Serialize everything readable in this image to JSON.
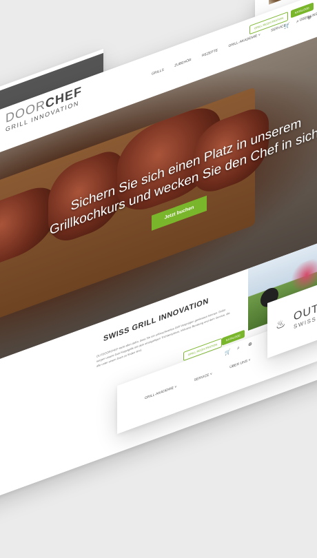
{
  "main": {
    "logo_line1_a": "DOOR",
    "logo_line1_b": "CHEF",
    "logo_line2": "GRILL INNOVATION",
    "menu": [
      "GRILLS",
      "ZUBEHÖR",
      "REZEPTE",
      "GRILL-AKADEMIE ˅",
      "SERVICE ˅",
      "ÜBER UNS ˅"
    ],
    "btn_register": "GRILL REGISTRATION",
    "btn_catalog": "KATALOGE",
    "hero_title": "Sichern Sie sich einen Platz in unserem Grillkochkurs und wecken Sie den Chef in sich!",
    "hero_button": "Jetzt buchen",
    "section_title": "SWISS GRILL INNOVATION",
    "section_text": "OUTDOORCHEF steht allen dafür, dass Sie ein unbeschwertes Grill-Vergnügen geniessen können. Dafür sorgen unsere Gas-Kugelgrills mit dem einzigartigen Trichtersystem, inklusive Beratung und dem Service, die alle unter einem Dach zu finden sind."
  },
  "nav2": {
    "menu": [
      "GRILL-AKADEMIE ˅",
      "SERVICE ˅",
      "ÜBER UNS ˅"
    ],
    "btn_register": "GRILL REGISTRATION",
    "btn_catalog": "KATALOGE"
  },
  "right_card": {
    "logo_line1": "OUTD",
    "logo_line2": "SWISS G"
  },
  "colors": {
    "accent": "#7ab62b",
    "dark_grey": "#555555"
  }
}
